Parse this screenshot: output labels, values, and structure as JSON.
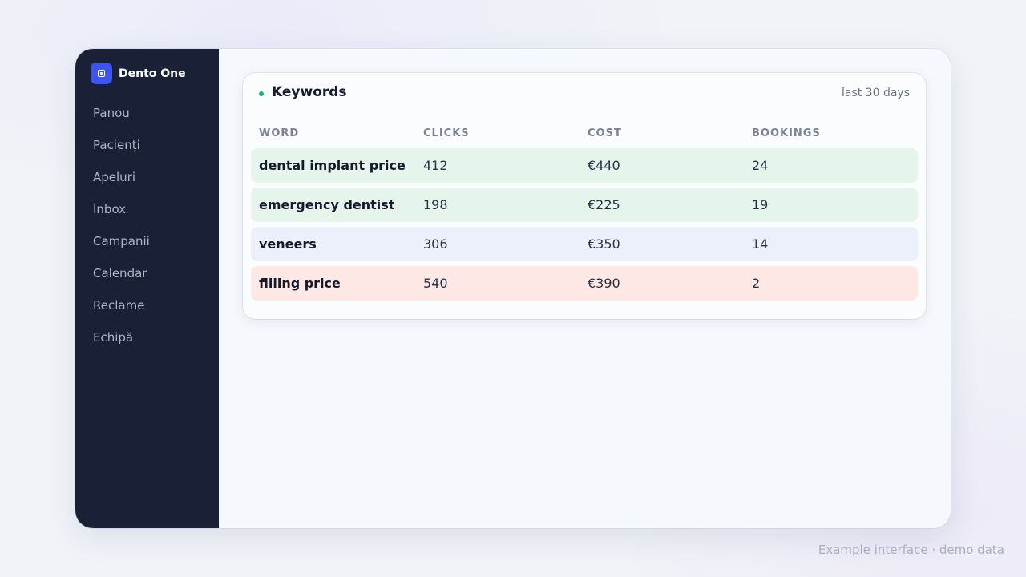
{
  "app": {
    "name": "Dento One"
  },
  "sidebar": {
    "items": [
      {
        "label": "Panou"
      },
      {
        "label": "Pacienți"
      },
      {
        "label": "Apeluri"
      },
      {
        "label": "Inbox"
      },
      {
        "label": "Campanii"
      },
      {
        "label": "Calendar"
      },
      {
        "label": "Reclame"
      },
      {
        "label": "Echipă"
      }
    ]
  },
  "card": {
    "title": "Keywords",
    "range": "last 30 days",
    "status_color": "#1fb86a",
    "columns": [
      "WORD",
      "CLICKS",
      "COST",
      "BOOKINGS"
    ],
    "rows": [
      {
        "word": "dental implant price",
        "clicks": "412",
        "cost": "€440",
        "bookings": "24",
        "color": "#e5f5ec"
      },
      {
        "word": "emergency dentist",
        "clicks": "198",
        "cost": "€225",
        "bookings": "19",
        "color": "#e5f5ec"
      },
      {
        "word": "veneers",
        "clicks": "306",
        "cost": "€350",
        "bookings": "14",
        "color": "#ebf0fb"
      },
      {
        "word": "filling price",
        "clicks": "540",
        "cost": "€390",
        "bookings": "2",
        "color": "#fde8e6"
      }
    ]
  },
  "footer": {
    "note": "Example interface · demo data"
  },
  "colors": {
    "sidebar_bg": "#1a2036",
    "brand_accent": "#3d55f0"
  }
}
